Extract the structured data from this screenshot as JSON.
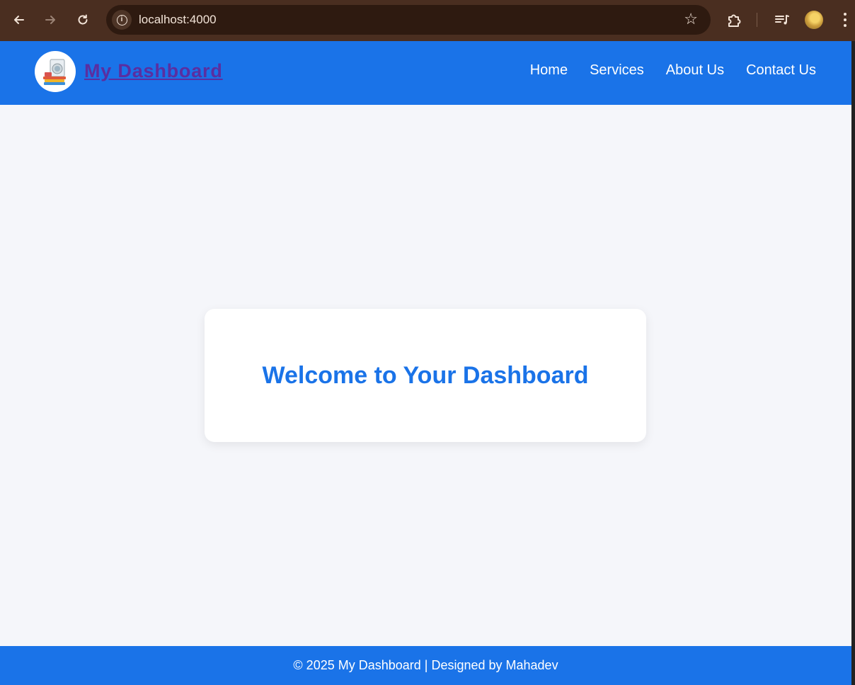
{
  "browser": {
    "url": "localhost:4000",
    "icons": [
      "back-arrow-icon",
      "forward-arrow-icon",
      "reload-icon",
      "info-icon",
      "star-icon",
      "extensions-icon",
      "media-control-icon",
      "profile-avatar",
      "more-menu-icon"
    ]
  },
  "header": {
    "brand": "My Dashboard",
    "nav": [
      "Home",
      "Services",
      "About Us",
      "Contact Us"
    ],
    "bg_color": "#1a73e8",
    "brand_color": "#5b2ea0"
  },
  "main": {
    "welcome_title": "Welcome to Your Dashboard",
    "title_color": "#1a73e8"
  },
  "footer": {
    "text": "© 2025 My Dashboard | Designed by Mahadev"
  }
}
